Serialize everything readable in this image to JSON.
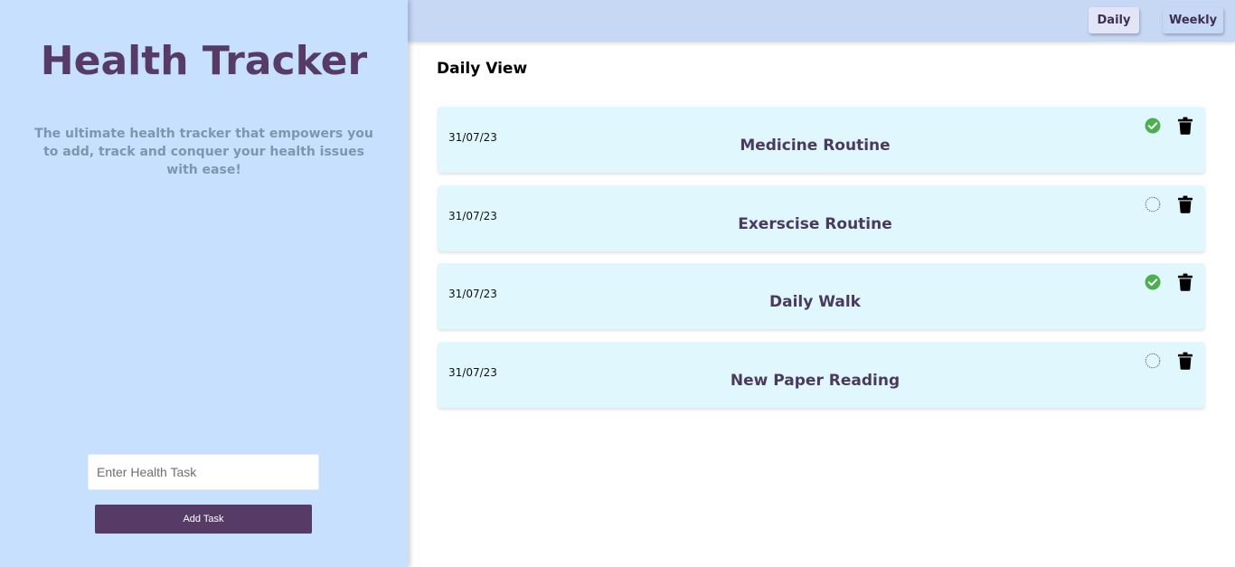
{
  "sidebar": {
    "title": "Health Tracker",
    "tagline": "The ultimate health tracker that empowers you to add, track and conquer your health issues with ease!",
    "input": {
      "placeholder": "Enter Health Task",
      "value": ""
    },
    "add_button_label": "Add Task"
  },
  "topbar": {
    "daily_label": "Daily",
    "weekly_label": "Weekly"
  },
  "main": {
    "view_title": "Daily View",
    "tasks": [
      {
        "date": "31/07/23",
        "name": "Medicine Routine",
        "completed": true
      },
      {
        "date": "31/07/23",
        "name": "Exerscise Routine",
        "completed": false
      },
      {
        "date": "31/07/23",
        "name": "Daily Walk",
        "completed": true
      },
      {
        "date": "31/07/23",
        "name": "New Paper Reading",
        "completed": false
      }
    ]
  },
  "colors": {
    "sidebar_bg": "#c7e0fe",
    "brand_purple": "#553b66",
    "card_bg": "#e0f7fd",
    "done_green": "#4caf50"
  },
  "icons": {
    "done": "check-circle-icon",
    "pending": "empty-circle-icon",
    "delete": "trash-icon"
  }
}
